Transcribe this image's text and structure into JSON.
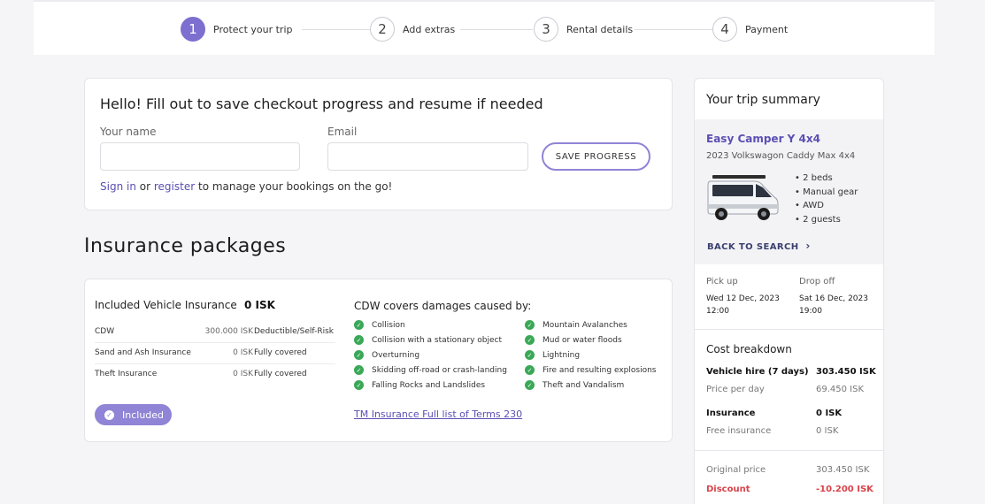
{
  "steps": [
    {
      "num": "1",
      "label": "Protect your trip"
    },
    {
      "num": "2",
      "label": "Add extras"
    },
    {
      "num": "3",
      "label": "Rental details"
    },
    {
      "num": "4",
      "label": "Payment"
    }
  ],
  "save_form": {
    "title": "Hello! Fill out to save checkout progress and resume if needed",
    "name_label": "Your name",
    "email_label": "Email",
    "name_value": "",
    "email_value": "",
    "save_button": "SAVE PROGRESS",
    "sign_in": "Sign in",
    "or": "or",
    "register": "register",
    "manage_text": "to manage your bookings on the go!"
  },
  "insurance": {
    "section_title": "Insurance packages",
    "package_name": "Included Vehicle Insurance",
    "package_price": "0 ISK",
    "rows": [
      {
        "name": "CDW",
        "price": "300.000 ISK",
        "coverage": "Deductible/Self-Risk"
      },
      {
        "name": "Sand and Ash Insurance",
        "price": "0 ISK",
        "coverage": "Fully covered"
      },
      {
        "name": "Theft Insurance",
        "price": "0 ISK",
        "coverage": "Fully covered"
      }
    ],
    "included_label": "Included",
    "cdw_title": "CDW covers damages caused by:",
    "cdw_left": [
      "Collision",
      "Collision with a stationary object",
      "Overturning",
      "Skidding off-road or crash-landing",
      "Falling Rocks and Landslides"
    ],
    "cdw_right": [
      "Mountain Avalanches",
      "Mud or water floods",
      "Lightning",
      "Fire and resulting explosions",
      "Theft and Vandalism"
    ],
    "terms_link": "TM Insurance Full list of Terms 230"
  },
  "summary": {
    "title": "Your trip summary",
    "vehicle_name": "Easy Camper Y 4x4",
    "vehicle_model": "2023 Volkswagon Caddy Max 4x4",
    "features": [
      "2 beds",
      "Manual gear",
      "AWD",
      "2 guests"
    ],
    "back_link": "BACK TO SEARCH",
    "pickup_label": "Pick up",
    "pickup_date": "Wed 12 Dec, 2023",
    "pickup_time": "12:00",
    "dropoff_label": "Drop off",
    "dropoff_date": "Sat 16 Dec, 2023",
    "dropoff_time": "19:00",
    "cost_title": "Cost breakdown",
    "vehicle_hire_label": "Vehicle hire (7 days)",
    "vehicle_hire_value": "303.450 ISK",
    "price_per_day_label": "Price per day",
    "price_per_day_value": "69.450 ISK",
    "insurance_label": "Insurance",
    "insurance_value": "0 ISK",
    "free_insurance_label": "Free insurance",
    "free_insurance_value": "0 ISK",
    "original_price_label": "Original price",
    "original_price_value": "303.450 ISK",
    "discount_label": "Discount",
    "discount_value": "-10.200 ISK"
  },
  "colors": {
    "accent": "#7d6fd0",
    "link": "#5b4fb3",
    "check_green": "#3aa857",
    "discount_red": "#d9424a"
  }
}
